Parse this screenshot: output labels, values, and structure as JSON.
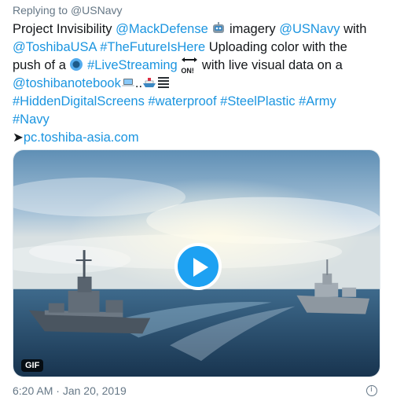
{
  "reply": {
    "prefix": "Replying to",
    "handle": "@USNavy"
  },
  "tweet_text": {
    "line1_a": "Project Invisibility ",
    "line1_mention1": "@MackDefense",
    "line1_b": " imagery ",
    "line1_mention2": "@USNavy",
    "line1_c": " with",
    "line2_mention": "@ToshibaUSA",
    "line2_hashtag": "#TheFutureIsHere",
    "line2_b": " Uploading color with the",
    "line3_a": "push of a ",
    "line3_hashtag": "#LiveStreaming",
    "line3_on": "ON!",
    "line3_b": " with live visual data on a",
    "line4_mention": "@toshibanotebook",
    "line4_dots": "..",
    "line5_hashtags": "#HiddenDigitalScreens #waterproof #SteelPlastic #Army",
    "line6_hashtag": "#Navy",
    "line7_arrow": "➤",
    "line7_link": "pc.toshiba-asia.com"
  },
  "media": {
    "badge": "GIF"
  },
  "footer": {
    "time": "6:20 AM",
    "separator": "·",
    "date": "Jan 20, 2019"
  },
  "colors": {
    "link": "#1b95e0",
    "play_button": "#1da1f2",
    "muted_text": "#657786"
  },
  "icons": [
    "robot-icon",
    "blue-circle-icon",
    "on-arrow-icon",
    "laptop-icon",
    "ship-icon",
    "stack-icon",
    "play-icon",
    "info-icon"
  ]
}
